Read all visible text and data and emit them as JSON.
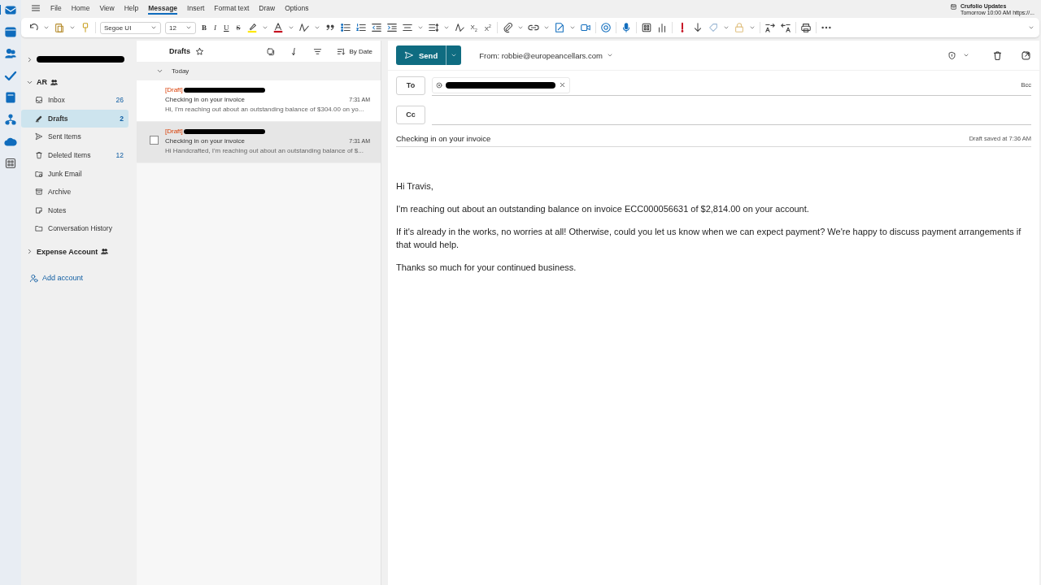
{
  "menu": {
    "tabs": [
      {
        "label": "File",
        "selected": false
      },
      {
        "label": "Home",
        "selected": false
      },
      {
        "label": "View",
        "selected": false
      },
      {
        "label": "Help",
        "selected": false
      },
      {
        "label": "Message",
        "selected": true
      },
      {
        "label": "Insert",
        "selected": false
      },
      {
        "label": "Format text",
        "selected": false
      },
      {
        "label": "Draw",
        "selected": false
      },
      {
        "label": "Options",
        "selected": false
      }
    ]
  },
  "notification": {
    "title": "Crufolio Updates",
    "detail": "Tomorrow 10:00 AM https://..."
  },
  "toolbar": {
    "font": "Segoe UI",
    "size": "12",
    "style_buttons": [
      "B",
      "I",
      "U",
      "S"
    ],
    "script_buttons": [
      "X$_{2}$",
      "X$^{2}$"
    ]
  },
  "folder_pane": {
    "accounts": [
      {
        "redacted": true,
        "expanded": false,
        "shared": false
      },
      {
        "name": "AR",
        "redacted": false,
        "expanded": true,
        "shared": true,
        "folders": [
          {
            "kind": "inbox",
            "name": "Inbox",
            "count": "26",
            "selected": false
          },
          {
            "kind": "drafts",
            "name": "Drafts",
            "count": "2",
            "selected": true
          },
          {
            "kind": "sent",
            "name": "Sent Items",
            "selected": false
          },
          {
            "kind": "deleted",
            "name": "Deleted Items",
            "count": "12",
            "selected": false
          },
          {
            "kind": "junk",
            "name": "Junk Email",
            "selected": false
          },
          {
            "kind": "archive",
            "name": "Archive",
            "selected": false
          },
          {
            "kind": "notes",
            "name": "Notes",
            "selected": false
          },
          {
            "kind": "folder",
            "name": "Conversation History",
            "selected": false
          }
        ]
      },
      {
        "name": "Expense Account",
        "redacted": false,
        "expanded": false,
        "shared": true
      }
    ],
    "add_account": "Add account"
  },
  "message_list": {
    "title": "Drafts",
    "sort": "By Date",
    "groups": [
      {
        "label": "Today",
        "expanded": true,
        "messages": [
          {
            "tag": "[Draft]",
            "sender_redacted": true,
            "subject": "Checking in on your invoice",
            "time": "7:31 AM",
            "preview": "Hi, I'm reaching out about an outstanding balance of $304.00 on yo...",
            "selected": false
          },
          {
            "tag": "[Draft]",
            "sender_redacted": true,
            "subject": "Checking in on your invoice",
            "time": "7:31 AM",
            "preview": "Hi Handcrafted, I'm reaching out about an outstanding balance of $...",
            "selected": true
          }
        ]
      }
    ]
  },
  "compose": {
    "send": "Send",
    "from": "From: robbie@europeancellars.com",
    "to_label": "To",
    "to_recipients": [
      {
        "redacted": true
      }
    ],
    "bcc": "Bcc",
    "cc_label": "Cc",
    "subject": "Checking in on your invoice",
    "saved": "Draft saved at 7:36 AM",
    "body": [
      "Hi Travis,",
      "I'm reaching out about an outstanding balance on invoice ECC000056631 of $2,814.00 on your account.",
      "If it's already in the works, no worries at all! Otherwise, could you let us know when we can expect payment? We're happy to discuss payment arrangements if that would help.",
      "Thanks so much for your continued business."
    ]
  }
}
